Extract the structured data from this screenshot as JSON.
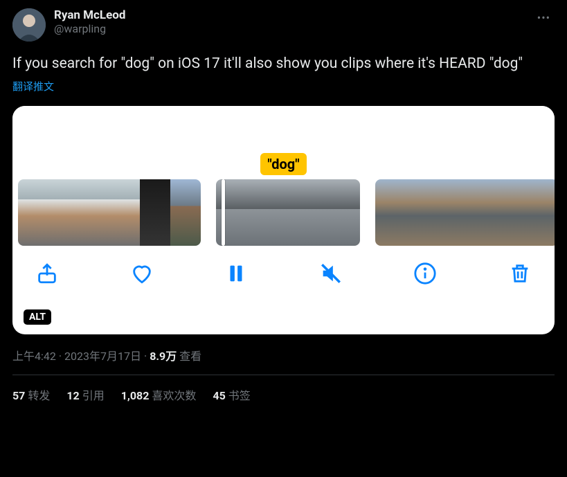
{
  "user": {
    "display_name": "Ryan McLeod",
    "handle": "@warpling"
  },
  "tweet_text": "If you search for \"dog\" on iOS 17 it'll also show you clips where it's HEARD \"dog\"",
  "translate_label": "翻译推文",
  "media": {
    "search_tag": "\"dog\"",
    "alt_badge": "ALT"
  },
  "meta": {
    "time": "上午4:42",
    "date": "2023年7月17日",
    "views_number": "8.9万",
    "views_label": "查看"
  },
  "stats": {
    "retweets_num": "57",
    "retweets_label": "转发",
    "quotes_num": "12",
    "quotes_label": "引用",
    "likes_num": "1,082",
    "likes_label": "喜欢次数",
    "bookmarks_num": "45",
    "bookmarks_label": "书签"
  }
}
